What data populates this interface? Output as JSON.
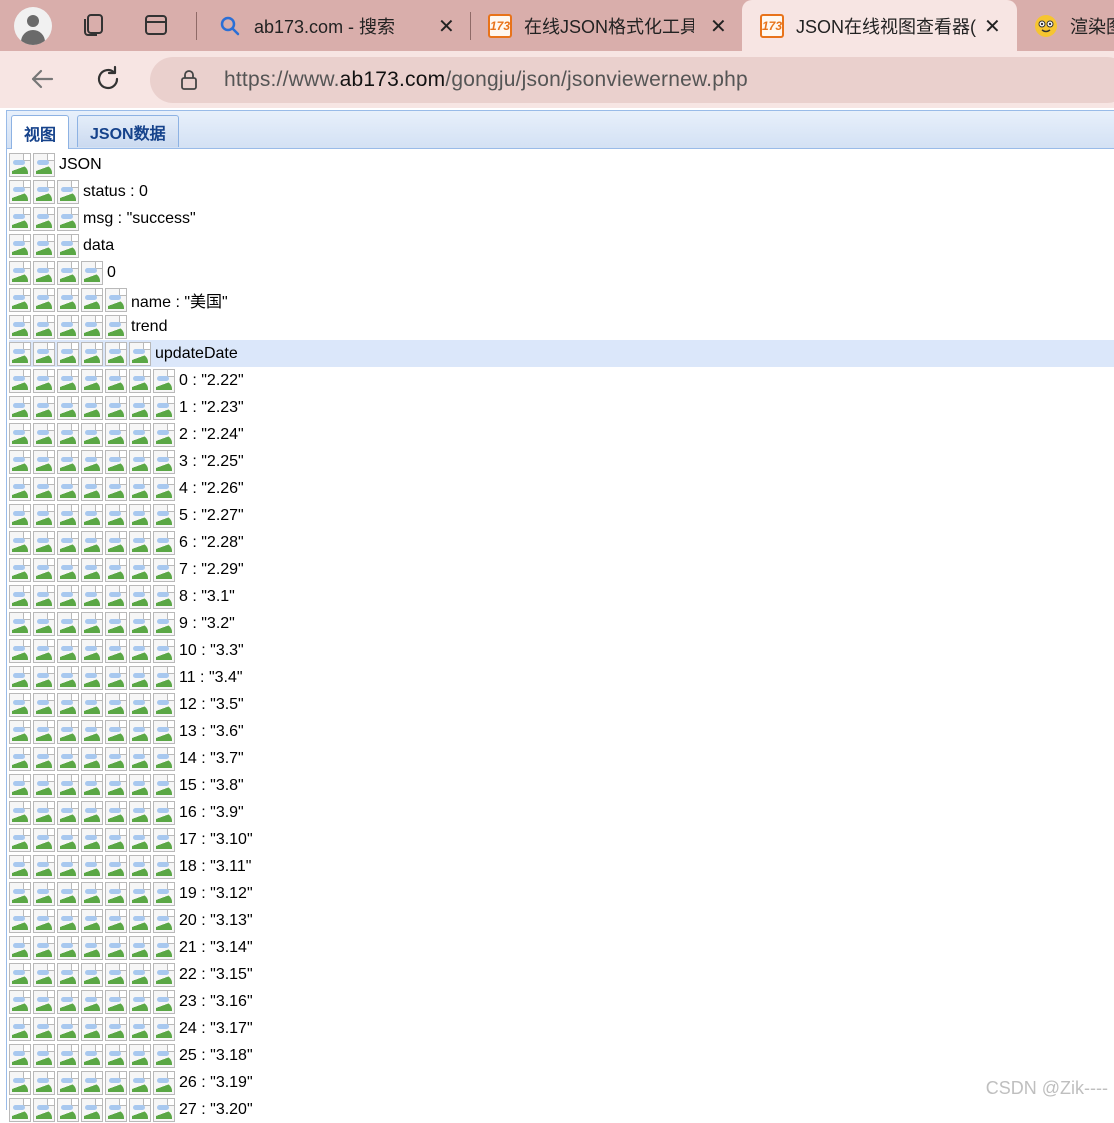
{
  "browser": {
    "tabs": [
      {
        "title": "ab173.com - 搜索",
        "icon": "search-icon",
        "active": false
      },
      {
        "title": "在线JSON格式化工具-",
        "icon": "ab173-favicon",
        "active": false
      },
      {
        "title": "JSON在线视图查看器(",
        "icon": "ab173-favicon",
        "active": true
      },
      {
        "title": "渲染图",
        "icon": "emoji-favicon",
        "active": false
      }
    ],
    "favicon_text": "173",
    "close_glyph": "✕",
    "url_prefix": "https://www.",
    "url_host": "ab173.com",
    "url_path": "/gongju/json/jsonviewernew.php"
  },
  "viewer": {
    "tabs": [
      {
        "label": "视图",
        "active": true
      },
      {
        "label": "JSON数据",
        "active": false
      }
    ],
    "tree": [
      {
        "depth": 2,
        "text": "JSON"
      },
      {
        "depth": 3,
        "text": "status : 0"
      },
      {
        "depth": 3,
        "text": "msg : \"success\""
      },
      {
        "depth": 3,
        "text": "data"
      },
      {
        "depth": 4,
        "text": "0"
      },
      {
        "depth": 5,
        "text": "name : \"美国\""
      },
      {
        "depth": 5,
        "text": "trend"
      },
      {
        "depth": 6,
        "text": "updateDate",
        "selected": true
      },
      {
        "depth": 7,
        "text": "0 : \"2.22\""
      },
      {
        "depth": 7,
        "text": "1 : \"2.23\""
      },
      {
        "depth": 7,
        "text": "2 : \"2.24\""
      },
      {
        "depth": 7,
        "text": "3 : \"2.25\""
      },
      {
        "depth": 7,
        "text": "4 : \"2.26\""
      },
      {
        "depth": 7,
        "text": "5 : \"2.27\""
      },
      {
        "depth": 7,
        "text": "6 : \"2.28\""
      },
      {
        "depth": 7,
        "text": "7 : \"2.29\""
      },
      {
        "depth": 7,
        "text": "8 : \"3.1\""
      },
      {
        "depth": 7,
        "text": "9 : \"3.2\""
      },
      {
        "depth": 7,
        "text": "10 : \"3.3\""
      },
      {
        "depth": 7,
        "text": "11 : \"3.4\""
      },
      {
        "depth": 7,
        "text": "12 : \"3.5\""
      },
      {
        "depth": 7,
        "text": "13 : \"3.6\""
      },
      {
        "depth": 7,
        "text": "14 : \"3.7\""
      },
      {
        "depth": 7,
        "text": "15 : \"3.8\""
      },
      {
        "depth": 7,
        "text": "16 : \"3.9\""
      },
      {
        "depth": 7,
        "text": "17 : \"3.10\""
      },
      {
        "depth": 7,
        "text": "18 : \"3.11\""
      },
      {
        "depth": 7,
        "text": "19 : \"3.12\""
      },
      {
        "depth": 7,
        "text": "20 : \"3.13\""
      },
      {
        "depth": 7,
        "text": "21 : \"3.14\""
      },
      {
        "depth": 7,
        "text": "22 : \"3.15\""
      },
      {
        "depth": 7,
        "text": "23 : \"3.16\""
      },
      {
        "depth": 7,
        "text": "24 : \"3.17\""
      },
      {
        "depth": 7,
        "text": "25 : \"3.18\""
      },
      {
        "depth": 7,
        "text": "26 : \"3.19\""
      },
      {
        "depth": 7,
        "text": "27 : \"3.20\""
      }
    ]
  },
  "watermark": "CSDN @Zik----",
  "colors": {
    "tabstrip": "#d9aeab",
    "active_tab": "#f7e5e3",
    "selected_row": "#dbe7fa",
    "viewer_tab_text": "#15428b"
  }
}
